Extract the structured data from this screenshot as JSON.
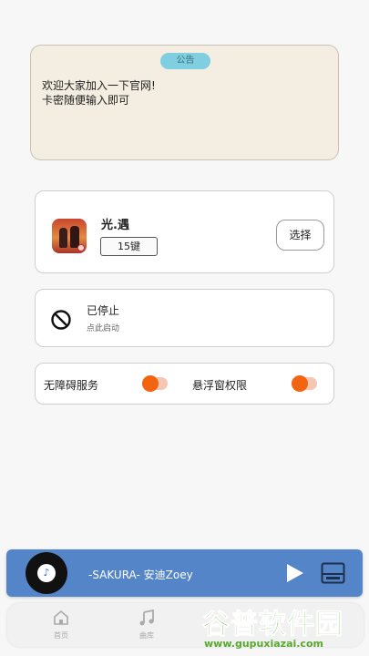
{
  "notice": {
    "badge": "公告",
    "text": "欢迎大家加入一下官网!\n卡密随便输入即可"
  },
  "game": {
    "name": "光.遇",
    "keys": "15键",
    "select_label": "选择"
  },
  "status": {
    "title": "已停止",
    "subtitle": "点此启动"
  },
  "permissions": {
    "accessibility_label": "无障碍服务",
    "accessibility_on": false,
    "overlay_label": "悬浮窗权限",
    "overlay_on": false,
    "accent_color": "#f2640f"
  },
  "player": {
    "song": "-SAKURA- 安迪Zoey",
    "icons": [
      "music-note-icon",
      "play-icon",
      "playlist-icon"
    ],
    "color": "#5585c9"
  },
  "nav": {
    "items": [
      {
        "label": "首页",
        "icon": "home-icon"
      },
      {
        "label": "曲库",
        "icon": "music-icon"
      }
    ]
  },
  "watermark": {
    "title": "谷普软件园",
    "url": "www.gupuxiazai.com"
  }
}
